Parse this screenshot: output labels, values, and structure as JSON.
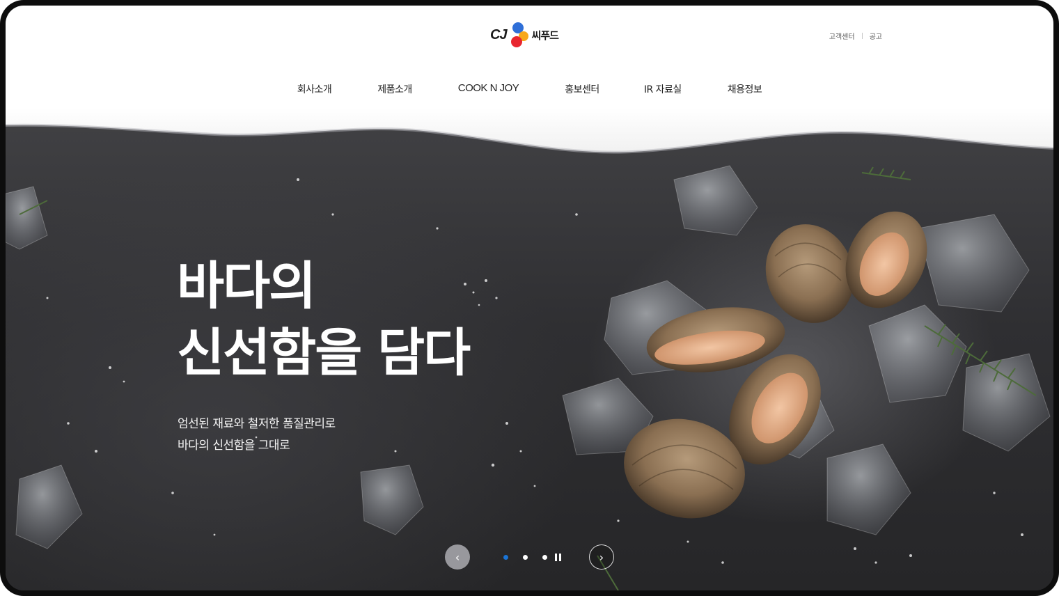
{
  "brand": {
    "cj": "CJ",
    "name": "씨푸드",
    "colors": {
      "blue": "#2f6fd8",
      "red": "#e8262f",
      "orange": "#f7a81b"
    }
  },
  "util_links": [
    {
      "label": "고객센터"
    },
    {
      "label": "공고"
    }
  ],
  "nav": {
    "items": [
      {
        "label": "회사소개"
      },
      {
        "label": "제품소개"
      },
      {
        "label": "COOK N JOY"
      },
      {
        "label": "홍보센터"
      },
      {
        "label": "IR 자료실"
      },
      {
        "label": "채용정보"
      }
    ]
  },
  "hero": {
    "headline_line1": "바다의",
    "headline_line2": "신선함을 담다",
    "sub_line1": "엄선된 재료와 철저한 품질관리로",
    "sub_line2": "바다의 신선함을 그대로"
  },
  "slider": {
    "prev_icon": "chevron-left-icon",
    "next_icon": "chevron-right-icon",
    "pause_icon": "pause-icon",
    "prev_glyph": "‹",
    "next_glyph": "›",
    "slide_count": 3,
    "active_index": 0,
    "active_color": "#1a74d6"
  }
}
